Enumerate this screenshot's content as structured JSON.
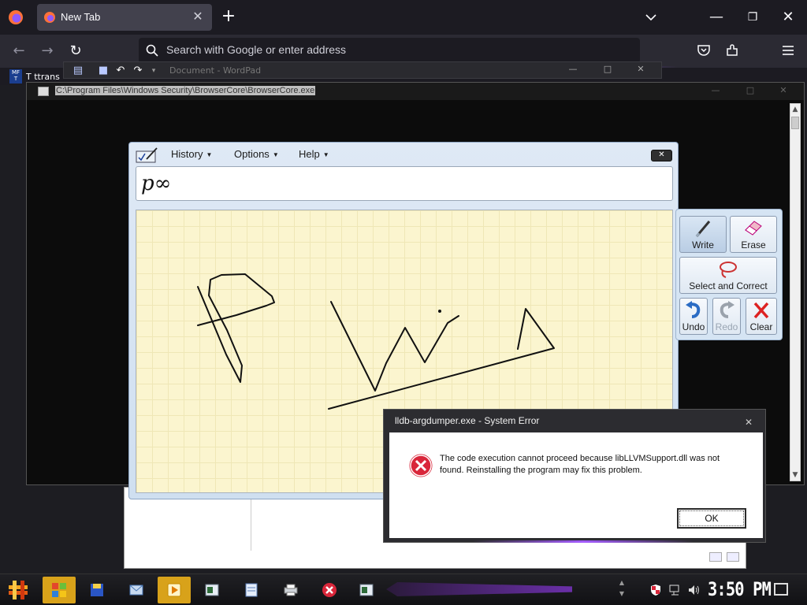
{
  "browser": {
    "tab_title": "New Tab",
    "address_placeholder": "Search with Google or enter address",
    "bookmark_label": "T ttrans"
  },
  "wordpad": {
    "title": "Document - WordPad"
  },
  "console": {
    "path": "C:\\Program Files\\Windows Security\\BrowserCore\\BrowserCore.exe"
  },
  "math_input": {
    "menus": [
      "History",
      "Options",
      "Help"
    ],
    "preview": "p∞",
    "tools": {
      "write": "Write",
      "erase": "Erase",
      "select_correct": "Select and Correct",
      "undo": "Undo",
      "redo": "Redo",
      "clear": "Clear"
    }
  },
  "error_dialog": {
    "title": "lldb-argdumper.exe - System Error",
    "message": "The code execution cannot proceed because libLLVMSupport.dll was not found. Reinstalling the program may fix this problem.",
    "ok_label": "OK"
  },
  "taskbar": {
    "clock": "3:50 PM"
  },
  "colors": {
    "accent_purple": "#8a4cff",
    "canvas_bg": "#fbf5cf",
    "error_red": "#d9263a",
    "active_task": "#d8a21a"
  }
}
